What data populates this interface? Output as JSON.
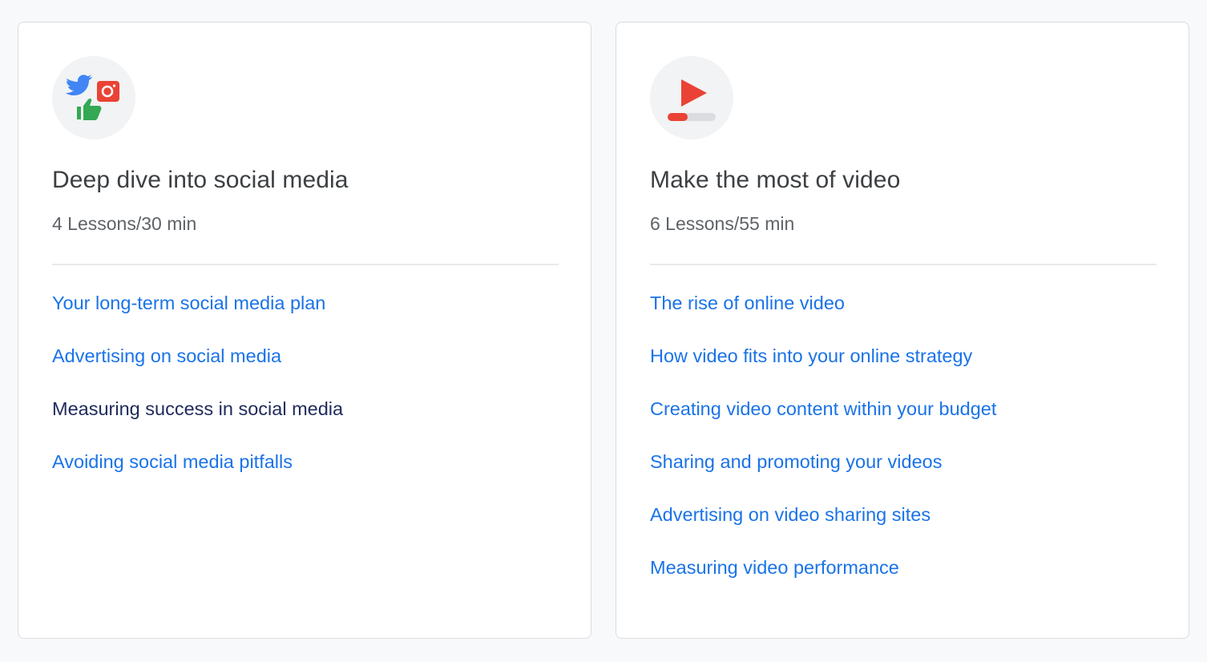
{
  "colors": {
    "link": "#1a73e8",
    "current_link": "#202b5c",
    "title": "#3c4043",
    "meta": "#5f6368",
    "icon_bg": "#f1f3f4",
    "red": "#ea4335",
    "blue": "#4285f4",
    "green": "#34a853"
  },
  "cards": [
    {
      "icon": "social-media-icon",
      "title": "Deep dive into social media",
      "meta": "4 Lessons/30 min",
      "lessons": [
        "Your long-term social media plan",
        "Advertising on social media",
        "Measuring success in social media",
        "Avoiding social media pitfalls"
      ]
    },
    {
      "icon": "video-play-icon",
      "title": "Make the most of video",
      "meta": "6 Lessons/55 min",
      "lessons": [
        "The rise of online video",
        "How video fits into your online strategy",
        "Creating video content within your budget",
        "Sharing and promoting your videos",
        "Advertising on video sharing sites",
        "Measuring video performance"
      ]
    }
  ]
}
